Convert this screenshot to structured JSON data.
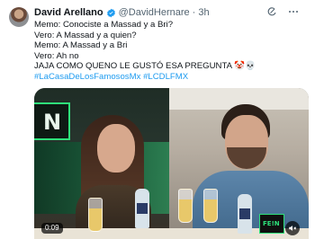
{
  "author": {
    "name": "David Arellano",
    "handle": "@DavidHernare",
    "separator": "·",
    "time": "3h"
  },
  "tweet": {
    "lines": [
      "Memo: Conociste a Massad y a Bri?",
      "Vero: A Massad y a quien?",
      "Memo: A Massad y a Bri",
      "Vero: Ah no",
      "JAJA COMO QUENO LE GUSTÓ ESA PREGUNTA 🤡💀"
    ],
    "hashtags": [
      "#LaCasaDeLosFamososMx",
      "#LCDLFMX"
    ]
  },
  "video": {
    "duration": "0:09"
  },
  "icons": {
    "verified": "verified-badge-icon",
    "grok": "grok-icon",
    "more": "more-options-icon",
    "mute": "speaker-muted-icon"
  },
  "colors": {
    "link": "#1d9bf0",
    "text": "#0f1419",
    "muted": "#536471"
  }
}
